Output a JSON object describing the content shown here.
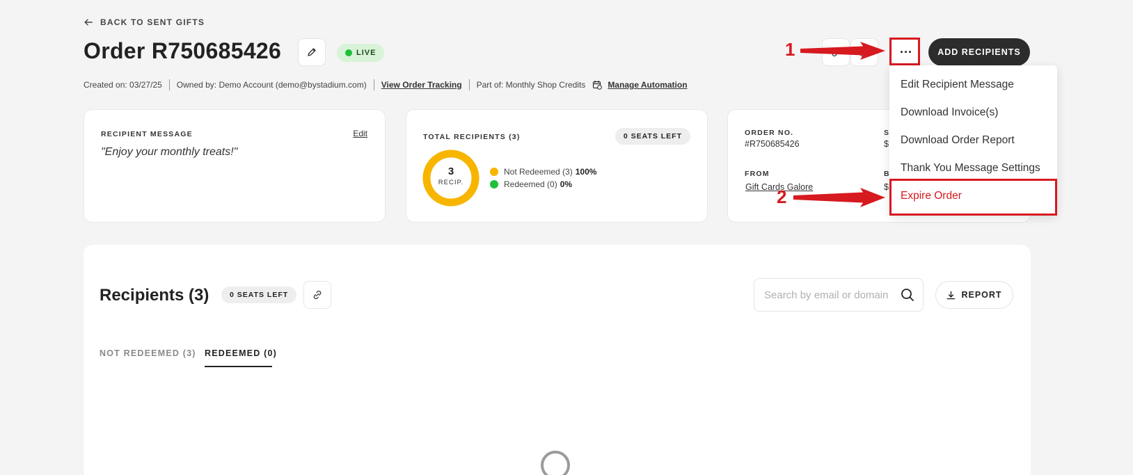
{
  "header": {
    "back_label": "BACK TO SENT GIFTS",
    "title": "Order R750685426",
    "status": "LIVE",
    "add_recipients_label": "ADD RECIPIENTS",
    "more_label": "···"
  },
  "meta": {
    "created": "Created on: 03/27/25",
    "owned": "Owned by: Demo Account (demo@bystadium.com)",
    "view_tracking": "View Order Tracking",
    "part_of": "Part of: Monthly Shop Credits",
    "manage_automation": "Manage Automation"
  },
  "cards": {
    "message": {
      "label": "RECIPIENT MESSAGE",
      "edit_label": "Edit",
      "text": "\"Enjoy your monthly treats!\""
    },
    "recipients": {
      "label": "TOTAL RECIPIENTS (3)",
      "seats_left": "0 SEATS LEFT",
      "donut_count": "3",
      "donut_caption": "RECIP.",
      "not_redeemed_label": "Not Redeemed (3)",
      "not_redeemed_pct": "100%",
      "redeemed_label": "Redeemed (0)",
      "redeemed_pct": "0%",
      "not_redeemed_fraction": 1.0,
      "not_redeemed_color": "#f7b500",
      "redeemed_color": "#1fbf3a"
    },
    "order": {
      "order_no_label": "ORDER NO.",
      "order_no_value": "#R750685426",
      "from_label": "FROM",
      "from_value": "Gift Cards Galore",
      "s_label": "S",
      "s_value": "$",
      "b_label": "B",
      "b_value": "$"
    }
  },
  "menu": {
    "items": [
      "Edit Recipient Message",
      "Download Invoice(s)",
      "Download Order Report",
      "Thank You Message Settings",
      "Expire Order"
    ]
  },
  "recipients_panel": {
    "title": "Recipients (3)",
    "seats_left": "0 SEATS LEFT",
    "search_placeholder": "Search by email or domain",
    "report_label": "REPORT",
    "tabs": [
      "NOT REDEEMED (3)",
      "REDEEMED (0)"
    ]
  },
  "annotations": {
    "step1": "1",
    "step2": "2",
    "color": "#d71920"
  }
}
